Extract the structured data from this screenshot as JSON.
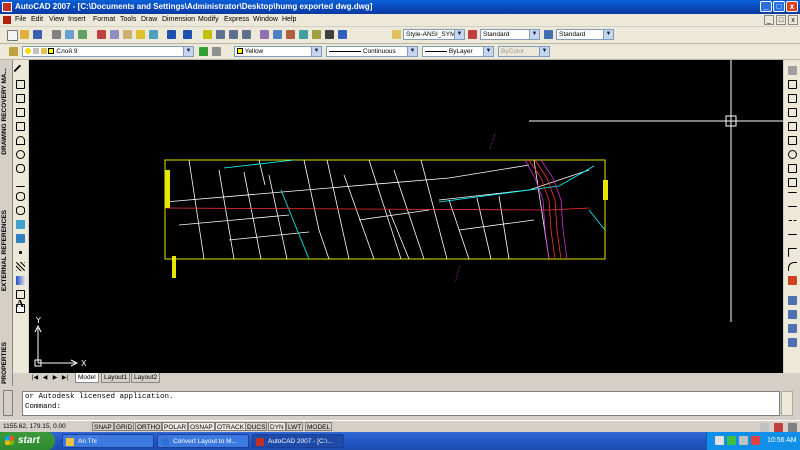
{
  "window": {
    "title": "AutoCAD 2007 - [C:\\Documents and Settings\\Administrator\\Desktop\\humg exported dwg.dwg]",
    "controls": [
      "_",
      "□",
      "x"
    ],
    "doc_controls": [
      "_",
      "□",
      "x"
    ]
  },
  "menu": [
    "File",
    "Edit",
    "View",
    "Insert",
    "Format",
    "Tools",
    "Draw",
    "Dimension",
    "Modify",
    "Express",
    "Window",
    "Help"
  ],
  "toolbar": {
    "text_style": "Style-ANSI_SYM",
    "dim_style": "Standard",
    "table_style": "Standard"
  },
  "properties": {
    "layer": "Слой 9",
    "color": "Yellow",
    "linetype": "Continuous",
    "lineweight": "ByLayer",
    "plotstyle": "ByColor"
  },
  "palettes": {
    "drawing_recovery": "DRAWING RECOVERY MA...",
    "external_references": "EXTERNAL REFERENCES",
    "properties": "PROPERTIES"
  },
  "ucs": {
    "x_label": "X",
    "y_label": "Y"
  },
  "tabs": [
    "Model",
    "Layout1",
    "Layout2"
  ],
  "command": {
    "history": "or Autodesk licensed application.",
    "prompt": "Command:"
  },
  "status": {
    "coords": "1155.62, 179.15, 0.00",
    "buttons": [
      "SNAP",
      "GRID",
      "ORTHO",
      "POLAR",
      "OSNAP",
      "OTRACK",
      "DUCS",
      "DYN",
      "LWT",
      "MODEL"
    ]
  },
  "taskbar": {
    "start": "start",
    "tasks": [
      "An Thi",
      "Convert Layout to M...",
      "AutoCAD 2007 - [C:\\..."
    ],
    "clock": "10:56 AM"
  },
  "colors": {
    "canvas_bg": "#000000",
    "frame": "#e6e600",
    "accent_red": "#ff3333",
    "accent_cyan": "#00ffff",
    "accent_magenta": "#cc33cc"
  }
}
